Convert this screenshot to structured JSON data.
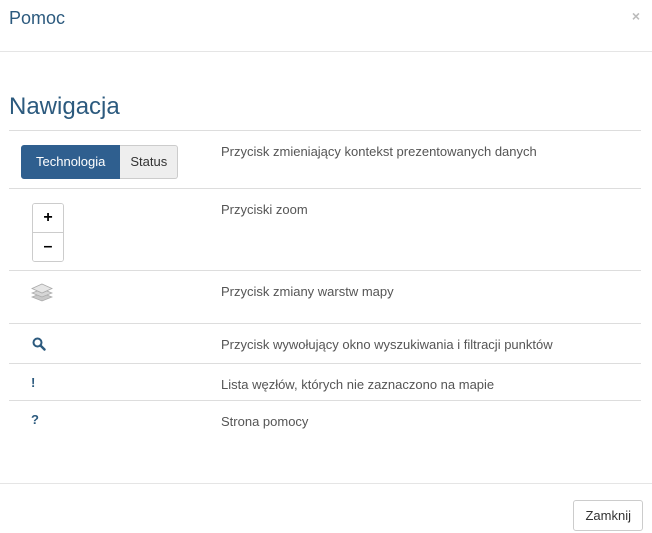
{
  "dialog": {
    "title": "Pomoc",
    "close_glyph": "×",
    "close_label": "Zamknij"
  },
  "section": {
    "title": "Nawigacja"
  },
  "rows": [
    {
      "control": {
        "toggle_active": "Technologia",
        "toggle_inactive": "Status"
      },
      "description": "Przycisk zmieniający kontekst prezentowanych danych"
    },
    {
      "control": {
        "zoom_in": "+",
        "zoom_out": "–"
      },
      "description": "Przyciski zoom"
    },
    {
      "icon": "layers-icon",
      "description": "Przycisk zmiany warstw mapy"
    },
    {
      "icon": "search-icon",
      "description": "Przycisk wywołujący okno wyszukiwania i filtracji punktów"
    },
    {
      "icon": "exclamation-icon",
      "glyph": "!",
      "description": "Lista węzłów, których nie zaznaczono na mapie"
    },
    {
      "icon": "question-icon",
      "glyph": "?",
      "description": "Strona pomocy"
    }
  ],
  "colors": {
    "accent": "#2c5a7e",
    "active_toggle_bg": "#2f5f8f",
    "inactive_toggle_bg": "#eeeeee"
  }
}
